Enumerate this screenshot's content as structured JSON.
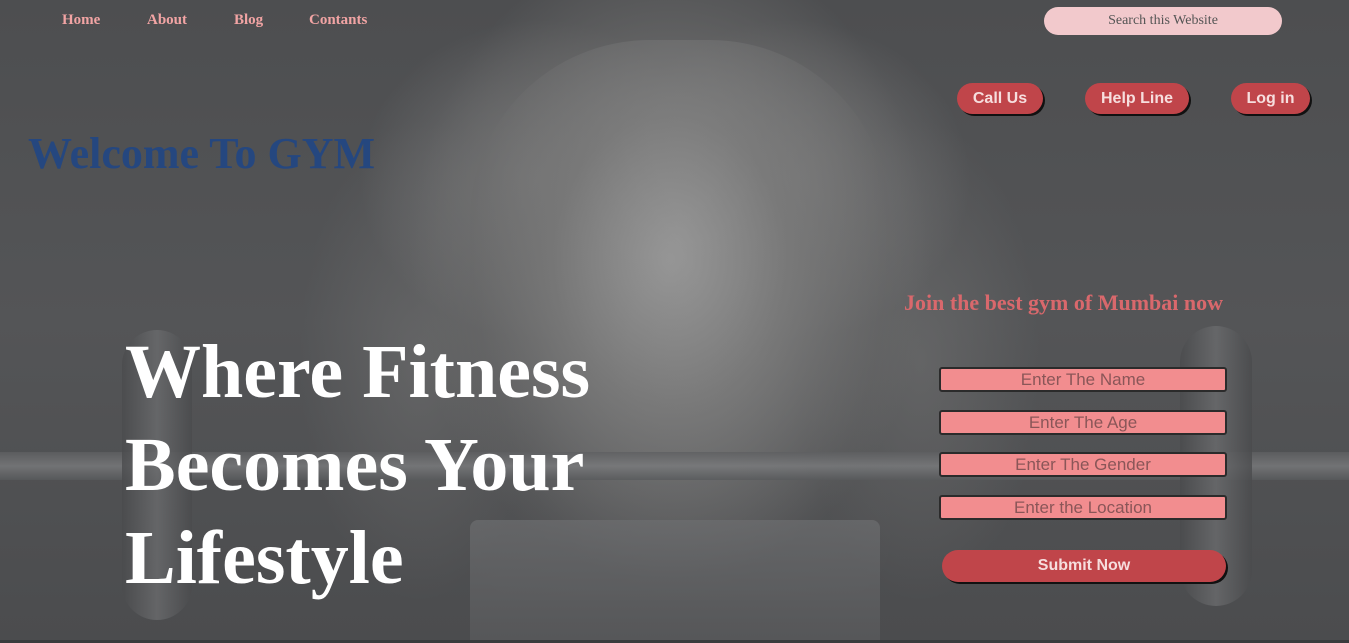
{
  "nav": {
    "home": "Home",
    "about": "About",
    "blog": "Blog",
    "contacts": "Contants"
  },
  "search": {
    "placeholder": "Search this Website"
  },
  "actions": {
    "call": "Call Us",
    "help": "Help Line",
    "login": "Log in"
  },
  "welcome": "Welcome To GYM",
  "hero": {
    "line1": "Where Fitness",
    "line2": "Becomes Your",
    "line3": "Lifestyle"
  },
  "form": {
    "heading": "Join the best gym of Mumbai now",
    "name_placeholder": "Enter The Name",
    "age_placeholder": "Enter The Age",
    "gender_placeholder": "Enter The Gender",
    "location_placeholder": "Enter the Location",
    "submit": "Submit Now"
  },
  "colors": {
    "nav_text": "#f2a4a4",
    "button_bg": "#c0454a",
    "field_bg": "#f28d8f",
    "welcome_text": "#25477f",
    "join_text": "#d9686c"
  }
}
